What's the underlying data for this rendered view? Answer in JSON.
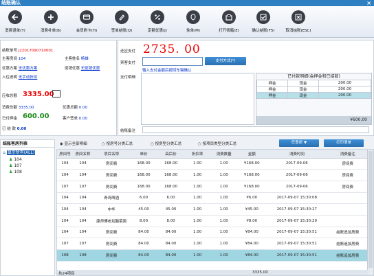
{
  "window": {
    "title": "结账确认",
    "close": "×"
  },
  "toolbar": [
    {
      "label": "消费退单(T)",
      "icon": "undo-icon"
    },
    {
      "label": "消费补单(B)",
      "icon": "add-icon"
    },
    {
      "label": "会员刷卡(H)",
      "icon": "card-icon"
    },
    {
      "label": "签单结账(Q)",
      "icon": "sign-icon"
    },
    {
      "label": "定额优惠(J)",
      "icon": "percent-icon"
    },
    {
      "label": "免单(M)",
      "icon": "free-icon"
    },
    {
      "label": "打开钱箱(E)",
      "icon": "cashbox-icon"
    },
    {
      "label": "确认结账(F5)",
      "icon": "confirm-icon"
    },
    {
      "label": "取消结账(ESC)",
      "icon": "cancel-icon"
    }
  ],
  "info": {
    "bill_no_label": "结账单号",
    "bill_no": "J22017090710001",
    "host_room_label": "主客房间",
    "host_room": "104",
    "host_name_label": "主客姓名",
    "host_name": "杨雄",
    "discount_plan_label": "优惠方案",
    "discount_plan": "无优惠方案",
    "promo_label": "促销优惠",
    "promo": "无促销优惠",
    "stay_label": "入住说明",
    "stay": "无手动折扣"
  },
  "amounts": {
    "due_label": "应收总额",
    "due": "3335.00",
    "consume_label": "消费总额",
    "consume": "3335.00",
    "discount_total_label": "优惠总额",
    "discount_total": "0.00",
    "paid_label": "已付押金",
    "paid": "600.00",
    "customer_sign_label": "客户签单",
    "customer_sign": "0.00",
    "settled_label": "已 结 款",
    "settled": "0.00"
  },
  "payment": {
    "still_pay_label": "还应支付",
    "still_pay": "2735. 00",
    "guest_pay_label": "宾客支付",
    "guest_pay_value": "",
    "method_button": "支付方式(*)",
    "desc_label": "支付明细",
    "hint": "输入支付金额后按回车键确认",
    "deposit_title": "已付款明细(会押金和已结款)",
    "deposit_rows": [
      [
        "押金",
        "现金",
        "200.00"
      ],
      [
        "押金",
        "现金",
        "200.00"
      ],
      [
        "押金",
        "现金",
        "200.00"
      ]
    ],
    "deposit_total": "¥600.00",
    "remark_label": "结账备注"
  },
  "rooms": {
    "header": "结账客房列表",
    "all": "显示所有(ALL)",
    "list": [
      "104",
      "107",
      "108"
    ]
  },
  "filters": {
    "options": [
      "显示全部明细",
      "按房号分类汇总",
      "按房型分类汇总",
      "按项目类型分类汇总"
    ],
    "selected_index": 0,
    "dropdown": "任意折",
    "print_button": "打印清单"
  },
  "table": {
    "headers": [
      "房间号",
      "房间名称",
      "项目名称",
      "单价",
      "高后价",
      "折扣率",
      "消费数量",
      "金额",
      "消费时间",
      "消费备注"
    ],
    "rows": [
      [
        "104",
        "104",
        "房间费",
        "168.00",
        "168.00",
        "1.00",
        "1.00",
        "¥168.00",
        "2017-09-06",
        "房间费"
      ],
      [
        "104",
        "104",
        "房间费",
        "168.00",
        "168.00",
        "1.00",
        "1.00",
        "¥168.00",
        "2017-09-06",
        "房间费"
      ],
      [
        "107",
        "107",
        "房间费",
        "168.00",
        "168.00",
        "1.00",
        "1.00",
        "¥168.00",
        "2017-09-06",
        "房间费"
      ],
      [
        "104",
        "104",
        "青岛啤酒",
        "6.00",
        "6.00",
        "1.00",
        "1.00",
        "¥6.00",
        "2017-09-07 15:30:08",
        ""
      ],
      [
        "104",
        "104",
        "中华",
        "45.00",
        "45.00",
        "1.00",
        "1.00",
        "¥45.00",
        "2017-09-07 15:30:27",
        ""
      ],
      [
        "104",
        "104",
        "康师傅老坛酸菜面",
        "8.00",
        "8.00",
        "1.00",
        "1.00",
        "¥8.00",
        "2017-09-07 15:30:29",
        ""
      ],
      [
        "104",
        "104",
        "房间费",
        "84.00",
        "84.00",
        "1.00",
        "1.00",
        "¥84.00",
        "2017-09-07 15:30:51",
        "结账追加房费"
      ],
      [
        "107",
        "107",
        "房间费",
        "84.00",
        "84.00",
        "1.00",
        "1.00",
        "¥84.00",
        "2017-09-07 15:30:51",
        "结账追加房费"
      ],
      [
        "108",
        "108",
        "房间费",
        "84.00",
        "84.00",
        "1.00",
        "1.00",
        "¥84.00",
        "2017-09-07 15:30:51",
        "结账追加房费"
      ]
    ],
    "selected_row": 8,
    "footer_count": "共24项目",
    "footer_total": "3335.00"
  }
}
